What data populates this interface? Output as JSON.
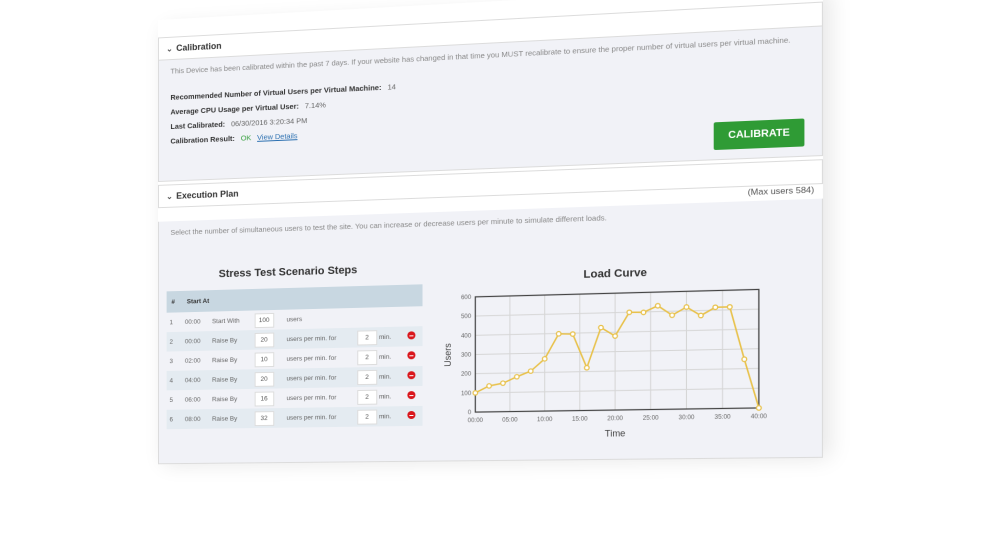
{
  "calibration": {
    "title": "Calibration",
    "description": "This Device has been calibrated within the past 7 days. If your website has changed in that time you MUST recalibrate to ensure the proper number of virtual users per virtual machine.",
    "fields": [
      {
        "label": "Recommended Number of Virtual Users per Virtual Machine:",
        "value": "14"
      },
      {
        "label": "Average CPU Usage per Virtual User:",
        "value": "7.14%"
      },
      {
        "label": "Last Calibrated:",
        "value": "06/30/2016 3:20:34 PM"
      }
    ],
    "result_label": "Calibration Result:",
    "result_value": "OK",
    "view_details": "View Details",
    "calibrate_button": "CALIBRATE"
  },
  "execution": {
    "title": "Execution Plan",
    "max_users": "(Max users 584)",
    "description": "Select the number of simultaneous users to test the site. You can increase or decrease users per minute to simulate different loads.",
    "steps_title": "Stress Test Scenario Steps",
    "columns": [
      "#",
      "Start At"
    ],
    "steps": [
      {
        "n": "1",
        "start": "00:00",
        "action": "Start With",
        "value": "100",
        "unit": "users",
        "duration": "",
        "dur_unit": ""
      },
      {
        "n": "2",
        "start": "00:00",
        "action": "Raise By",
        "value": "20",
        "unit": "users per min. for",
        "duration": "2",
        "dur_unit": "min."
      },
      {
        "n": "3",
        "start": "02:00",
        "action": "Raise By",
        "value": "10",
        "unit": "users per min. for",
        "duration": "2",
        "dur_unit": "min."
      },
      {
        "n": "4",
        "start": "04:00",
        "action": "Raise By",
        "value": "20",
        "unit": "users per min. for",
        "duration": "2",
        "dur_unit": "min."
      },
      {
        "n": "5",
        "start": "06:00",
        "action": "Raise By",
        "value": "16",
        "unit": "users per min. for",
        "duration": "2",
        "dur_unit": "min."
      },
      {
        "n": "6",
        "start": "08:00",
        "action": "Raise By",
        "value": "32",
        "unit": "users per min. for",
        "duration": "2",
        "dur_unit": "min."
      }
    ]
  },
  "colors": {
    "accent_green": "#2f9b35",
    "line": "#e8c14a",
    "remove_red": "#d9161c"
  },
  "chart_data": {
    "type": "line",
    "title": "Load Curve",
    "xlabel": "Time",
    "ylabel": "Users",
    "ylim": [
      0,
      600
    ],
    "xlim": [
      0,
      40
    ],
    "yticks": [
      0,
      100,
      200,
      300,
      400,
      500,
      600
    ],
    "xtick_labels": [
      "00:00",
      "05:00",
      "10:00",
      "15:00",
      "20:00",
      "25:00",
      "30:00",
      "35:00",
      "40:00"
    ],
    "grid": true,
    "x": [
      0,
      2,
      4,
      6,
      8,
      10,
      12,
      14,
      16,
      18,
      20,
      22,
      24,
      26,
      28,
      30,
      32,
      34,
      36,
      38,
      40
    ],
    "series": [
      {
        "name": "Users",
        "values": [
          100,
          135,
          148,
          180,
          208,
          270,
          398,
          395,
          220,
          425,
          380,
          500,
          498,
          530,
          480,
          520,
          475,
          515,
          515,
          248,
          0
        ]
      }
    ]
  }
}
